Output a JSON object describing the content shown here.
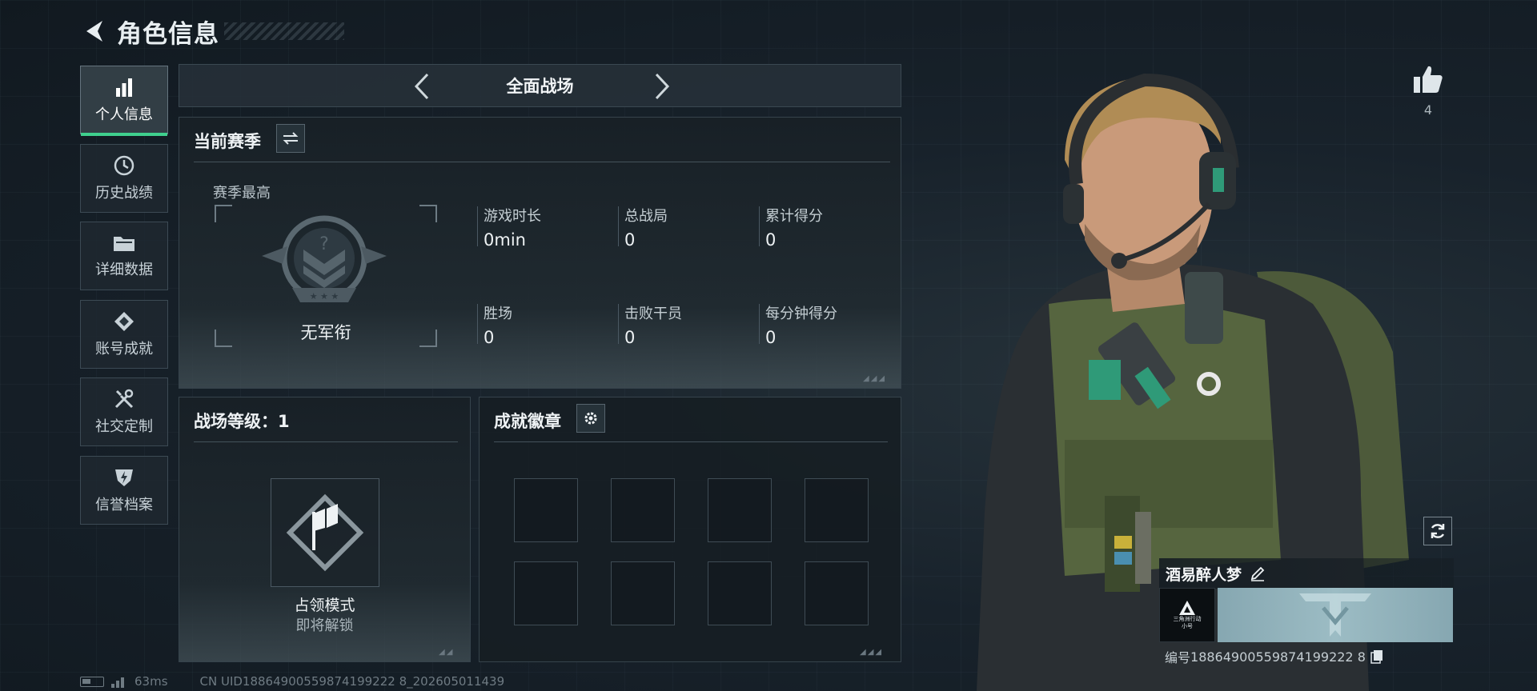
{
  "header": {
    "title": "角色信息"
  },
  "sidebar": {
    "items": [
      {
        "label": "个人信息",
        "icon": "bar-chart-icon",
        "active": true
      },
      {
        "label": "历史战绩",
        "icon": "history-clock-icon",
        "active": false
      },
      {
        "label": "详细数据",
        "icon": "folder-icon",
        "active": false
      },
      {
        "label": "账号成就",
        "icon": "achievement-badge-icon",
        "active": false
      },
      {
        "label": "社交定制",
        "icon": "tools-icon",
        "active": false
      },
      {
        "label": "信誉档案",
        "icon": "shield-lightning-icon",
        "active": false
      }
    ]
  },
  "mode_selector": {
    "label": "全面战场"
  },
  "season": {
    "title": "当前赛季",
    "best_label": "赛季最高",
    "rank_name": "无军衔",
    "stats": [
      {
        "label": "游戏时长",
        "value": "0min"
      },
      {
        "label": "总战局",
        "value": "0"
      },
      {
        "label": "累计得分",
        "value": "0"
      },
      {
        "label": "胜场",
        "value": "0"
      },
      {
        "label": "击败干员",
        "value": "0"
      },
      {
        "label": "每分钟得分",
        "value": "0"
      }
    ]
  },
  "battlefield_level": {
    "title": "战场等级：1",
    "mode_name": "占领模式",
    "mode_status": "即将解锁"
  },
  "achievements": {
    "title": "成就徽章",
    "slots": 8
  },
  "profile": {
    "likes": "4",
    "player_name": "酒易醉人梦",
    "logo_text_1": "三角洲行动",
    "logo_text_2": "小号",
    "id_label": "编号",
    "id_value": "18864900559874199222 8"
  },
  "footer": {
    "ping": "63ms",
    "uid_text": "CN UID18864900559874199222 8_202605011439"
  },
  "colors": {
    "accent": "#3fd08e",
    "banner": "#9cbcc4"
  }
}
